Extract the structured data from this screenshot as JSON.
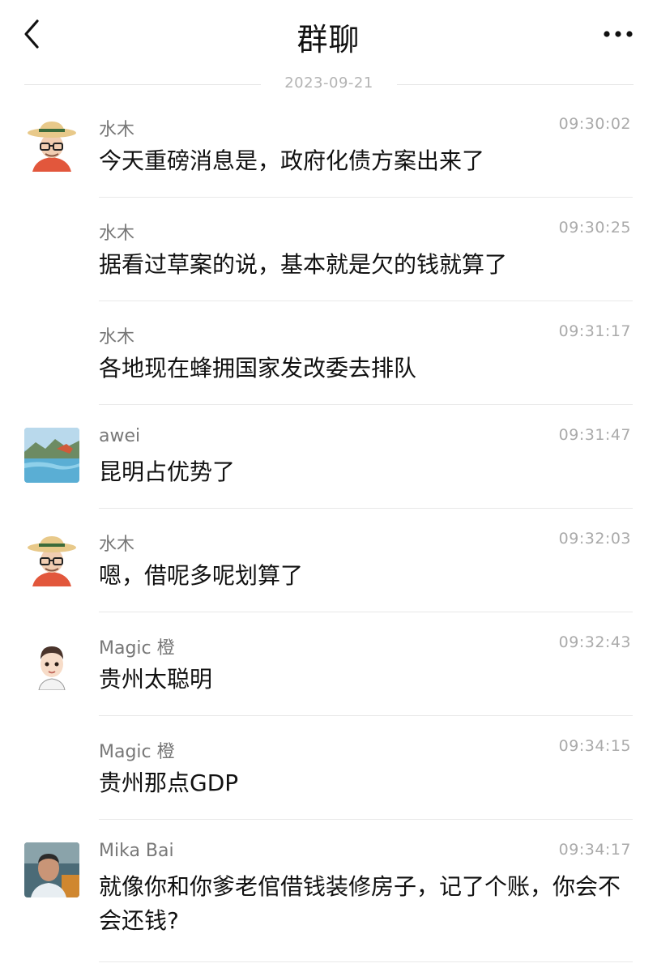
{
  "header": {
    "title": "群聊"
  },
  "date_separator": "2023-09-21",
  "messages": [
    {
      "sender": "水木",
      "time": "09:30:02",
      "text": "今天重磅消息是，政府化债方案出来了",
      "avatar": "straw-hat-man"
    },
    {
      "sender": "水木",
      "time": "09:30:25",
      "text": "据看过草案的说，基本就是欠的钱就算了",
      "avatar": null
    },
    {
      "sender": "水木",
      "time": "09:31:17",
      "text": "各地现在蜂拥国家发改委去排队",
      "avatar": null
    },
    {
      "sender": "awei",
      "time": "09:31:47",
      "text": "昆明占优势了",
      "avatar": "lake-landscape"
    },
    {
      "sender": "水木",
      "time": "09:32:03",
      "text": "嗯，借呢多呢划算了",
      "avatar": "straw-hat-man"
    },
    {
      "sender": "Magic 橙",
      "time": "09:32:43",
      "text": "贵州太聪明",
      "avatar": "cartoon-boy"
    },
    {
      "sender": "Magic 橙",
      "time": "09:34:15",
      "text": "贵州那点GDP",
      "avatar": null
    },
    {
      "sender": "Mika Bai",
      "time": "09:34:17",
      "text": "就像你和你爹老倌借钱装修房子，记了个账，你会不会还钱?",
      "avatar": "photo-man"
    }
  ],
  "colors": {
    "background": "#ffffff",
    "sender": "#777777",
    "time": "#aaaaaa",
    "divider": "#e8e8e8"
  }
}
